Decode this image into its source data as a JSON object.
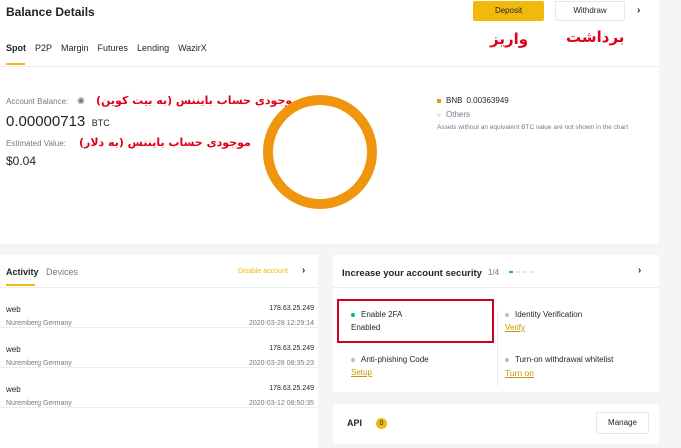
{
  "header": {
    "title": "Balance Details",
    "deposit_label": "Deposit",
    "withdraw_label": "Withdraw"
  },
  "annotations": {
    "deposit": "واریز",
    "withdraw": "برداشت",
    "balance_btc": "موجودی حساب بایننس (به بیت کوین)",
    "balance_usd": "موجودی حساب بایننس (به دلار)"
  },
  "tabs": [
    "Spot",
    "P2P",
    "Margin",
    "Futures",
    "Lending",
    "WazirX"
  ],
  "balance": {
    "account_label": "Account Balance:",
    "btc_value": "0.00000713",
    "btc_unit": "BTC",
    "estimated_label": "Estimated Value:",
    "usd_value": "$0.04"
  },
  "chart_data": {
    "type": "pie",
    "title": "",
    "series": [
      {
        "name": "BNB",
        "value": "0.00363949",
        "color": "#f0960e"
      },
      {
        "name": "Others",
        "value": "",
        "color": "#e6e8ea"
      }
    ],
    "note": "Assets without an equivalent BTC value are not shown in the chart"
  },
  "activity": {
    "tab_activity": "Activity",
    "tab_devices": "Devices",
    "disable_label": "Disable account",
    "rows": [
      {
        "source": "web",
        "ip": "178.63.25.249",
        "location": "Nuremberg Germany",
        "time": "2020-03-28 12:29:14"
      },
      {
        "source": "web",
        "ip": "178.63.25.249",
        "location": "Nuremberg Germany",
        "time": "2020-03-28 08:35:23"
      },
      {
        "source": "web",
        "ip": "178.63.25.249",
        "location": "Nuremberg Germany",
        "time": "2020-03-12 08:50:35"
      }
    ]
  },
  "security": {
    "title": "Increase your account security",
    "progress": "1/4",
    "items": [
      {
        "label": "Enable 2FA",
        "status": "Enabled",
        "dot_color": "#02c076"
      },
      {
        "label": "Identity Verification",
        "status": "Verify",
        "dot_color": "#b7bdc6"
      },
      {
        "label": "Anti-phishing Code",
        "status": "Setup",
        "dot_color": "#b7bdc6"
      },
      {
        "label": "Turn-on withdrawal whitelist",
        "status": "Turn on",
        "dot_color": "#b7bdc6"
      }
    ]
  },
  "api": {
    "label": "API",
    "count": "0",
    "manage_label": "Manage"
  },
  "colors": {
    "accent": "#f0b90b",
    "bnb": "#f0960e",
    "highlight_border": "#d0021b",
    "enabled_dot": "#02c076"
  }
}
